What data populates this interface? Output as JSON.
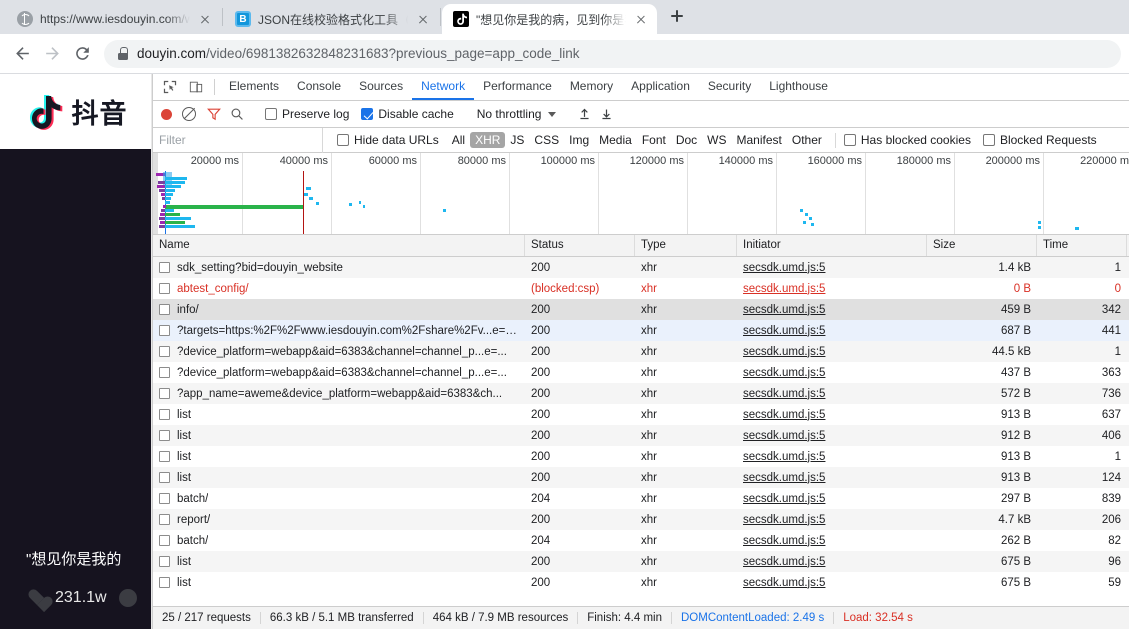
{
  "browser": {
    "tabs": [
      {
        "title": "https://www.iesdouyin.com/we",
        "favicon": "globe-icon",
        "active": false
      },
      {
        "title": "JSON在线校验格式化工具（Be",
        "favicon": "json-tool-icon",
        "active": false
      },
      {
        "title": "\"想见你是我的病，见到你是我",
        "favicon": "douyin-icon",
        "active": true
      }
    ],
    "new_tab_label": "+",
    "nav": {
      "back": "←",
      "forward": "→",
      "reload": "⟳"
    },
    "omnibox": {
      "lock": "lock-icon",
      "host": "douyin.com",
      "path": "/video/6981382632848231683?previous_page=app_code_link"
    }
  },
  "page": {
    "brand": "抖音",
    "caption": "\"想见你是我的",
    "stats": [
      {
        "icon": "heart-icon",
        "value": "231.1w"
      }
    ]
  },
  "devtools": {
    "icons": {
      "inspect": "inspect-element-icon",
      "device": "device-toolbar-icon"
    },
    "tabs": [
      {
        "label": "Elements",
        "selected": false
      },
      {
        "label": "Console",
        "selected": false
      },
      {
        "label": "Sources",
        "selected": false
      },
      {
        "label": "Network",
        "selected": true
      },
      {
        "label": "Performance",
        "selected": false
      },
      {
        "label": "Memory",
        "selected": false
      },
      {
        "label": "Application",
        "selected": false
      },
      {
        "label": "Security",
        "selected": false
      },
      {
        "label": "Lighthouse",
        "selected": false
      }
    ],
    "controls": {
      "record": "record-icon",
      "clear": "clear-icon",
      "filter": "filter-icon",
      "search": "search-icon",
      "preserve_log": {
        "label": "Preserve log",
        "checked": false
      },
      "disable_cache": {
        "label": "Disable cache",
        "checked": true
      },
      "throttling": "No throttling",
      "import_label": "import-har-icon",
      "export_label": "export-har-icon"
    },
    "filterbar": {
      "placeholder": "Filter",
      "hide_data_urls": {
        "label": "Hide data URLs",
        "checked": false
      },
      "types": [
        {
          "label": "All",
          "active": false
        },
        {
          "label": "XHR",
          "active": true
        },
        {
          "label": "JS",
          "active": false
        },
        {
          "label": "CSS",
          "active": false
        },
        {
          "label": "Img",
          "active": false
        },
        {
          "label": "Media",
          "active": false
        },
        {
          "label": "Font",
          "active": false
        },
        {
          "label": "Doc",
          "active": false
        },
        {
          "label": "WS",
          "active": false
        },
        {
          "label": "Manifest",
          "active": false
        },
        {
          "label": "Other",
          "active": false
        }
      ],
      "has_blocked_cookies": {
        "label": "Has blocked cookies",
        "checked": false
      },
      "blocked_requests": {
        "label": "Blocked Requests",
        "checked": false
      }
    },
    "overview": {
      "ticks": [
        "20000 ms",
        "40000 ms",
        "60000 ms",
        "80000 ms",
        "100000 ms",
        "120000 ms",
        "140000 ms",
        "160000 ms",
        "180000 ms",
        "200000 ms",
        "220000 m"
      ]
    },
    "table": {
      "columns": [
        "Name",
        "Status",
        "Type",
        "Initiator",
        "Size",
        "Time"
      ],
      "rows": [
        {
          "name": "sdk_setting?bid=douyin_website",
          "status": "200",
          "type": "xhr",
          "initiator": "secsdk.umd.js:5",
          "size": "1.4 kB",
          "time": "1",
          "error": false,
          "highlight": ""
        },
        {
          "name": "abtest_config/",
          "status": "(blocked:csp)",
          "type": "xhr",
          "initiator": "secsdk.umd.js:5",
          "size": "0 B",
          "time": "0",
          "error": true,
          "highlight": ""
        },
        {
          "name": "info/",
          "status": "200",
          "type": "xhr",
          "initiator": "secsdk.umd.js:5",
          "size": "459 B",
          "time": "342",
          "error": false,
          "highlight": "sel-gray"
        },
        {
          "name": "?targets=https:%2F%2Fwww.iesdouyin.com%2Fshare%2Fv...e=_...",
          "status": "200",
          "type": "xhr",
          "initiator": "secsdk.umd.js:5",
          "size": "687 B",
          "time": "441",
          "error": false,
          "highlight": "sel-blue"
        },
        {
          "name": "?device_platform=webapp&aid=6383&channel=channel_p...e=...",
          "status": "200",
          "type": "xhr",
          "initiator": "secsdk.umd.js:5",
          "size": "44.5 kB",
          "time": "1",
          "error": false,
          "highlight": ""
        },
        {
          "name": "?device_platform=webapp&aid=6383&channel=channel_p...e=...",
          "status": "200",
          "type": "xhr",
          "initiator": "secsdk.umd.js:5",
          "size": "437 B",
          "time": "363",
          "error": false,
          "highlight": ""
        },
        {
          "name": "?app_name=aweme&device_platform=webapp&aid=6383&ch...",
          "status": "200",
          "type": "xhr",
          "initiator": "secsdk.umd.js:5",
          "size": "572 B",
          "time": "736",
          "error": false,
          "highlight": ""
        },
        {
          "name": "list",
          "status": "200",
          "type": "xhr",
          "initiator": "secsdk.umd.js:5",
          "size": "913 B",
          "time": "637",
          "error": false,
          "highlight": ""
        },
        {
          "name": "list",
          "status": "200",
          "type": "xhr",
          "initiator": "secsdk.umd.js:5",
          "size": "912 B",
          "time": "406",
          "error": false,
          "highlight": ""
        },
        {
          "name": "list",
          "status": "200",
          "type": "xhr",
          "initiator": "secsdk.umd.js:5",
          "size": "913 B",
          "time": "1",
          "error": false,
          "highlight": ""
        },
        {
          "name": "list",
          "status": "200",
          "type": "xhr",
          "initiator": "secsdk.umd.js:5",
          "size": "913 B",
          "time": "124",
          "error": false,
          "highlight": ""
        },
        {
          "name": "batch/",
          "status": "204",
          "type": "xhr",
          "initiator": "secsdk.umd.js:5",
          "size": "297 B",
          "time": "839",
          "error": false,
          "highlight": ""
        },
        {
          "name": "report/",
          "status": "200",
          "type": "xhr",
          "initiator": "secsdk.umd.js:5",
          "size": "4.7 kB",
          "time": "206",
          "error": false,
          "highlight": ""
        },
        {
          "name": "batch/",
          "status": "204",
          "type": "xhr",
          "initiator": "secsdk.umd.js:5",
          "size": "262 B",
          "time": "82",
          "error": false,
          "highlight": ""
        },
        {
          "name": "list",
          "status": "200",
          "type": "xhr",
          "initiator": "secsdk.umd.js:5",
          "size": "675 B",
          "time": "96",
          "error": false,
          "highlight": ""
        },
        {
          "name": "list",
          "status": "200",
          "type": "xhr",
          "initiator": "secsdk.umd.js:5",
          "size": "675 B",
          "time": "59",
          "error": false,
          "highlight": ""
        }
      ]
    },
    "footer": {
      "requests": "25 / 217 requests",
      "transferred": "66.3 kB / 5.1 MB transferred",
      "resources": "464 kB / 7.9 MB resources",
      "finish": "Finish: 4.4 min",
      "dom_content_loaded": "DOMContentLoaded: 2.49 s",
      "load": "Load: 32.54 s"
    }
  },
  "colors": {
    "accent": "#1a73e8",
    "error": "#d93025",
    "record": "#db4437",
    "chrome_bg": "#dee1e6"
  }
}
